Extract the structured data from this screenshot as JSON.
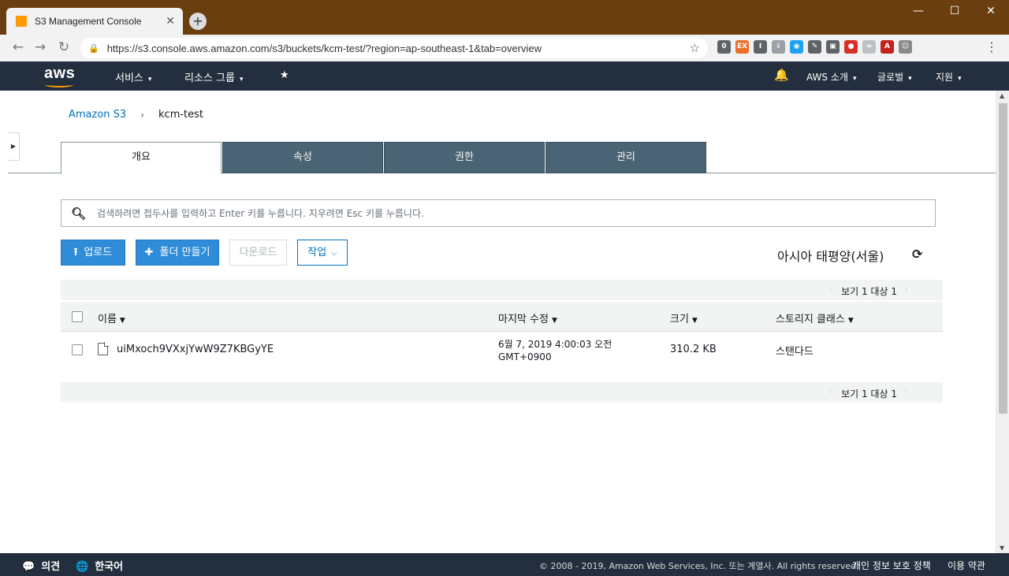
{
  "browser": {
    "tab_title": "S3 Management Console",
    "tab_close": "✕",
    "new_tab": "+",
    "url": "https://s3.console.aws.amazon.com/s3/buckets/kcm-test/?region=ap-southeast-1&tab=overview",
    "window_controls": {
      "minimize": "—",
      "maximize": "☐",
      "close": "✕"
    },
    "extensions": [
      {
        "name": "extension-0-icon",
        "label": "0",
        "color": "#5f6368"
      },
      {
        "name": "extension-ex-icon",
        "label": "EX",
        "color": "#e8702a"
      },
      {
        "name": "extension-i-icon",
        "label": "I",
        "color": "#5f6368"
      },
      {
        "name": "extension-download-icon",
        "label": "⇩",
        "color": "#9aa0a6"
      },
      {
        "name": "extension-eye-icon",
        "label": "◉",
        "color": "#1da1f2"
      },
      {
        "name": "extension-pen-icon",
        "label": "✎",
        "color": "#5f6368"
      },
      {
        "name": "extension-card-icon",
        "label": "▣",
        "color": "#5f6368"
      },
      {
        "name": "extension-stop-icon",
        "label": "●",
        "color": "#d93025"
      },
      {
        "name": "extension-link-icon",
        "label": "∞",
        "color": "#bdc1c6"
      },
      {
        "name": "extension-pdf-icon",
        "label": "A",
        "color": "#c5221f"
      },
      {
        "name": "extension-avatar-icon",
        "label": "☺",
        "color": "#8a8a8a"
      }
    ]
  },
  "aws_nav": {
    "logo": "aws",
    "services": "서비스",
    "resource_groups": "리소스 그룹",
    "pin_icon": "★",
    "bell_icon": "🔔",
    "account": "AWS 소개",
    "region": "글로벌",
    "support": "지원",
    "caret": "⌄"
  },
  "breadcrumb": {
    "root": "Amazon S3",
    "separator": "›",
    "current": "kcm-test"
  },
  "tabs": [
    "개요",
    "속성",
    "권한",
    "관리"
  ],
  "search": {
    "placeholder": "검색하려면 접두사를 입력하고 Enter 키를 누릅니다. 지우려면 Esc 키를 누릅니다."
  },
  "actions": {
    "upload": "업로드",
    "create_folder": "폴더 만들기",
    "download": "다운로드",
    "actions": "작업"
  },
  "region_label": "아시아 태평양(서울)",
  "pagination": {
    "label": "보기 1 대상 1",
    "prev": "‹",
    "next": "›"
  },
  "table": {
    "columns": [
      "이름",
      "마지막 수정",
      "크기",
      "스토리지 클래스"
    ],
    "sort_icon": "▼",
    "rows": [
      {
        "name": "uiMxoch9VXxjYwW9Z7KBGyYE",
        "modified_line1": "6월 7, 2019 4:00:03 오전",
        "modified_line2": "GMT+0900",
        "size": "310.2 KB",
        "storage_class": "스탠다드"
      }
    ]
  },
  "footer": {
    "feedback": "의견",
    "language": "한국어",
    "copyright": "© 2008 - 2019, Amazon Web Services, Inc. 또는 계열사. All rights reserved.",
    "privacy": "개인 정보 보호 정책",
    "terms": "이용 약관"
  },
  "colors": {
    "aws_nav_bg": "#232f3e",
    "aws_orange": "#ff9900",
    "primary_button": "#2e8cd8",
    "tab_inactive": "#4b6475",
    "link": "#0073bb"
  }
}
